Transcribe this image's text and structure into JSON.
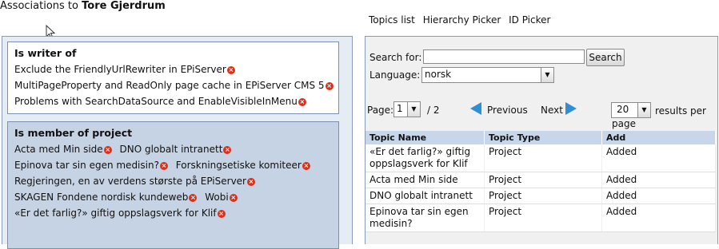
{
  "header": {
    "prefix": "Associations to",
    "name": "Tore Gjerdrum"
  },
  "tabs": [
    "Topics list",
    "Hierarchy Picker",
    "ID Picker"
  ],
  "writer": {
    "title": "Is writer of",
    "items": [
      "Exclude the FriendlyUrlRewriter in EPiServer",
      "MultiPageProperty and ReadOnly page cache in EPiServer CMS 5",
      "Problems with SearchDataSource and EnableVisibleInMenu"
    ]
  },
  "member": {
    "title": "Is member of project",
    "lines": [
      [
        "Acta med Min side",
        "DNO globalt intranett"
      ],
      [
        "Epinova tar sin egen medisin?",
        "Forskningsetiske komiteer"
      ],
      [
        "Regjeringen, en av verdens største på EPiServer"
      ],
      [
        "SKAGEN Fondene nordisk kundeweb",
        "Wobi"
      ],
      [
        "«Er det farlig?» giftig oppslagsverk for Klif"
      ]
    ]
  },
  "search": {
    "label": "Search for:",
    "value": "",
    "button": "Search",
    "language_label": "Language:",
    "language_value": "norsk"
  },
  "paging": {
    "page_label": "Page:",
    "page_value": "1",
    "page_total": "/ 2",
    "previous": "Previous",
    "next": "Next",
    "per_page_value": "20",
    "per_page_label": "results per page"
  },
  "table": {
    "headers": [
      "Topic Name",
      "Topic Type",
      "Add"
    ],
    "rows": [
      [
        "«Er det farlig?» giftig oppslagsverk for Klif",
        "Project",
        "Added"
      ],
      [
        "Acta med Min side",
        "Project",
        "Added"
      ],
      [
        "DNO globalt intranett",
        "Project",
        "Added"
      ],
      [
        "Epinova tar sin egen medisin?",
        "Project",
        "Added"
      ]
    ]
  },
  "icons": {
    "remove": "remove-icon",
    "previous": "arrow-left-icon",
    "next": "arrow-right-icon",
    "cursor": "mouse-cursor-icon"
  },
  "colors": {
    "remove_icon": "#d8321b",
    "arrow": "#2f8fd6",
    "member_box": "#c5d3e4",
    "table_header": "#c7d6e8"
  }
}
